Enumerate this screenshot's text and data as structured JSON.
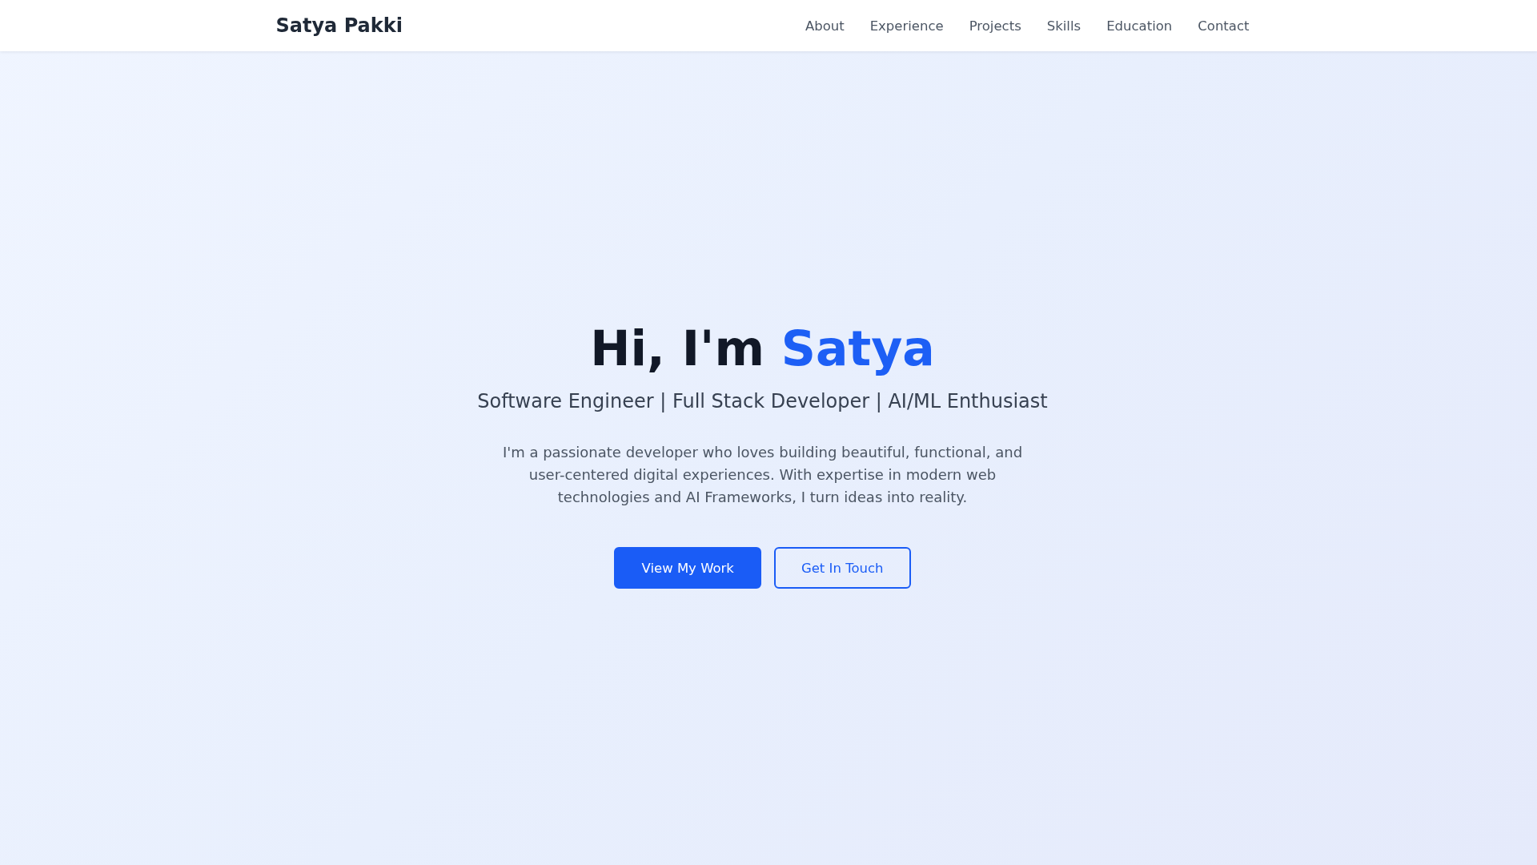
{
  "nav": {
    "brand": "Satya Pakki",
    "links": [
      {
        "label": "About"
      },
      {
        "label": "Experience"
      },
      {
        "label": "Projects"
      },
      {
        "label": "Skills"
      },
      {
        "label": "Education"
      },
      {
        "label": "Contact"
      }
    ]
  },
  "hero": {
    "greeting": "Hi, I'm",
    "name": "Satya",
    "tagline": "Software Engineer | Full Stack Developer | AI/ML Enthusiast",
    "intro": "I'm a passionate developer who loves building beautiful, functional, and user-centered digital experiences. With expertise in modern web technologies and AI Frameworks, I turn ideas into reality.",
    "buttons": [
      {
        "label": "View My Work",
        "kind": "primary"
      },
      {
        "label": "Get In Touch",
        "kind": "outline"
      }
    ]
  }
}
